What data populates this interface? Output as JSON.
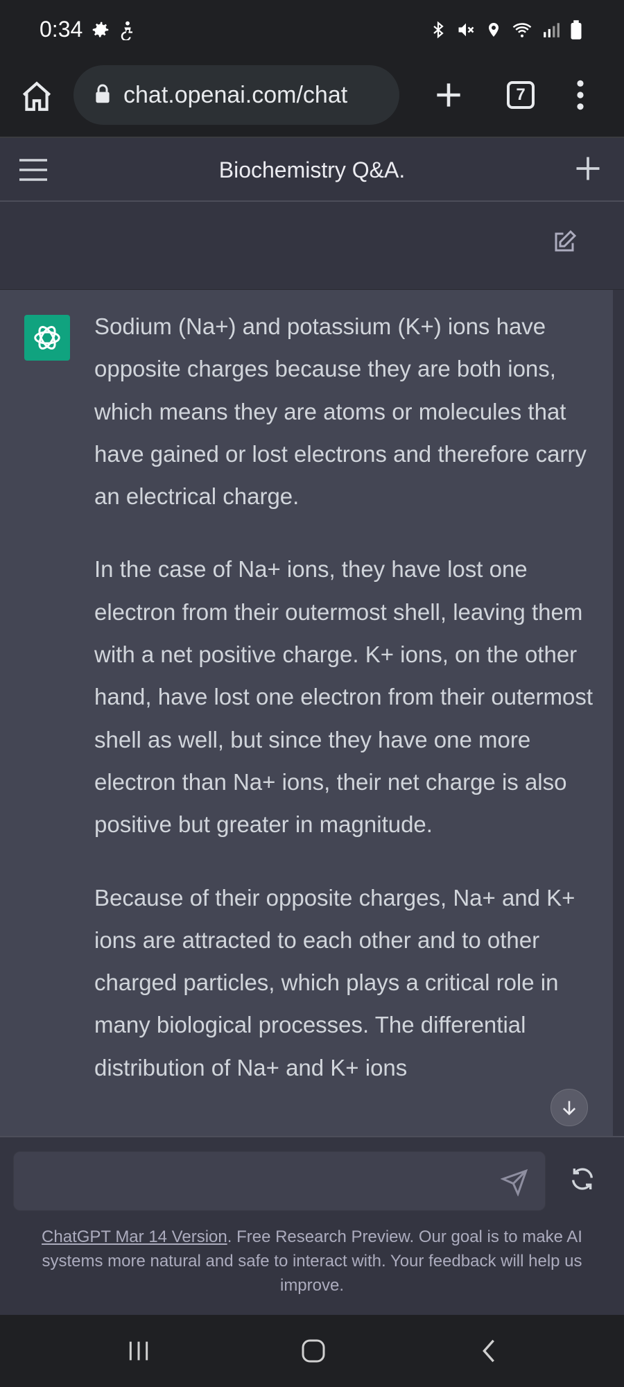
{
  "status_bar": {
    "time": "0:34",
    "left_icons": [
      "gear-icon",
      "accessibility-icon"
    ],
    "right_icons": [
      "bluetooth-icon",
      "mute-icon",
      "location-icon",
      "wifi-icon",
      "signal-icon",
      "battery-icon"
    ]
  },
  "browser": {
    "url": "chat.openai.com/chat",
    "tab_count": "7"
  },
  "header": {
    "title": "Biochemistry Q&A."
  },
  "messages": {
    "assistant": {
      "paragraphs": [
        "Sodium (Na+) and potassium (K+) ions have opposite charges because they are both ions, which means they are atoms or molecules that have gained or lost electrons and therefore carry an electrical charge.",
        "In the case of Na+ ions, they have lost one electron from their outermost shell, leaving them with a net positive charge. K+ ions, on the other hand, have lost one electron from their outermost shell as well, but since they have one more electron than Na+ ions, their net charge is also positive but greater in magnitude.",
        "Because of their opposite charges, Na+ and K+ ions are attracted to each other and to other charged particles, which plays a critical role in many biological processes. The differential distribution of Na+ and K+ ions"
      ]
    }
  },
  "composer": {
    "placeholder": "",
    "disclaimer_link": "ChatGPT Mar 14 Version",
    "disclaimer_text": ". Free Research Preview. Our goal is to make AI systems more natural and safe to interact with. Your feedback will help us improve."
  },
  "colors": {
    "assistant_bg": "#444654",
    "page_bg": "#343541",
    "avatar_green": "#10a37f",
    "system_bar": "#1f2023"
  }
}
